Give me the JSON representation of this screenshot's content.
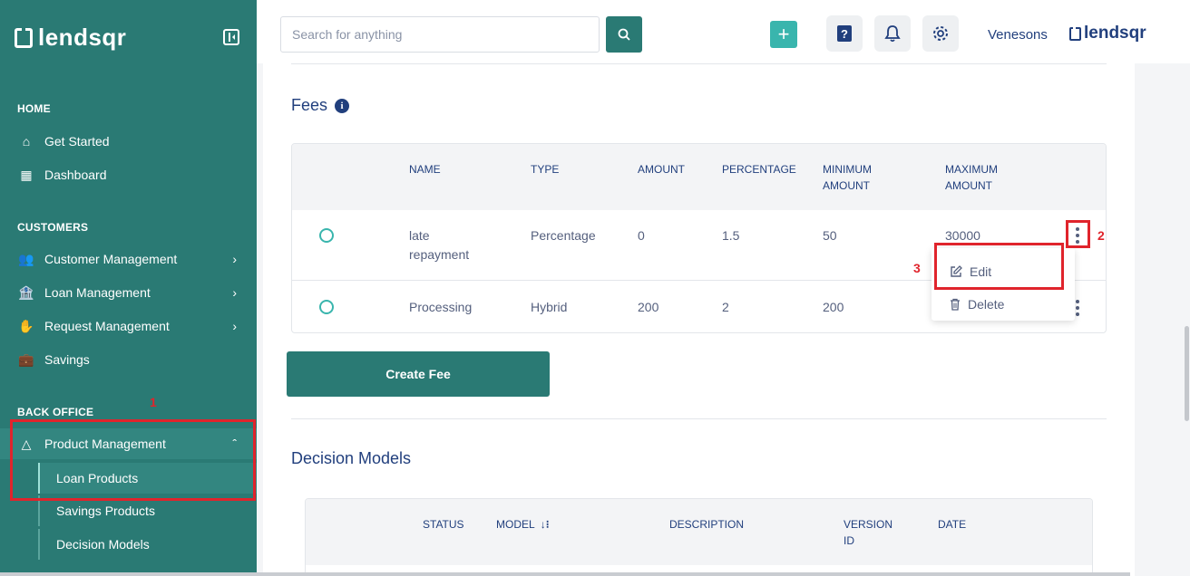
{
  "sidebar": {
    "logo": "lendsqr",
    "sections": {
      "home": "HOME",
      "customers": "CUSTOMERS",
      "back_office": "BACK OFFICE"
    },
    "items": {
      "get_started": "Get Started",
      "dashboard": "Dashboard",
      "customer_management": "Customer Management",
      "loan_management": "Loan Management",
      "request_management": "Request Management",
      "savings": "Savings",
      "product_management": "Product Management"
    },
    "sub_items": {
      "loan_products": "Loan Products",
      "savings_products": "Savings Products",
      "decision_models": "Decision Models"
    }
  },
  "header": {
    "search_placeholder": "Search for anything",
    "user_name": "Venesons",
    "logo": "lendsqr"
  },
  "fees": {
    "title": "Fees",
    "columns": {
      "name": "NAME",
      "type": "TYPE",
      "amount": "AMOUNT",
      "percentage": "PERCENTAGE",
      "min1": "MINIMUM",
      "min2": "AMOUNT",
      "max1": "MAXIMUM",
      "max2": "AMOUNT"
    },
    "rows": [
      {
        "name1": "late",
        "name2": "repayment",
        "type": "Percentage",
        "amount": "0",
        "percentage": "1.5",
        "minimum": "50",
        "maximum": "30000"
      },
      {
        "name1": "Processing",
        "type": "Hybrid",
        "amount": "200",
        "percentage": "2",
        "minimum": "200"
      }
    ],
    "menu": {
      "edit": "Edit",
      "delete": "Delete"
    },
    "create_button": "Create Fee"
  },
  "decision_models": {
    "title": "Decision Models",
    "columns": {
      "status": "STATUS",
      "model": "MODEL",
      "description": "DESCRIPTION",
      "version1": "VERSION",
      "version2": "ID",
      "date": "DATE"
    }
  },
  "annotations": {
    "one": "1",
    "two": "2",
    "three": "3"
  },
  "colors": {
    "brand": "#2a7a74",
    "accent": "#39b5ad",
    "annotation": "#e0242c",
    "navy": "#213f7d"
  }
}
